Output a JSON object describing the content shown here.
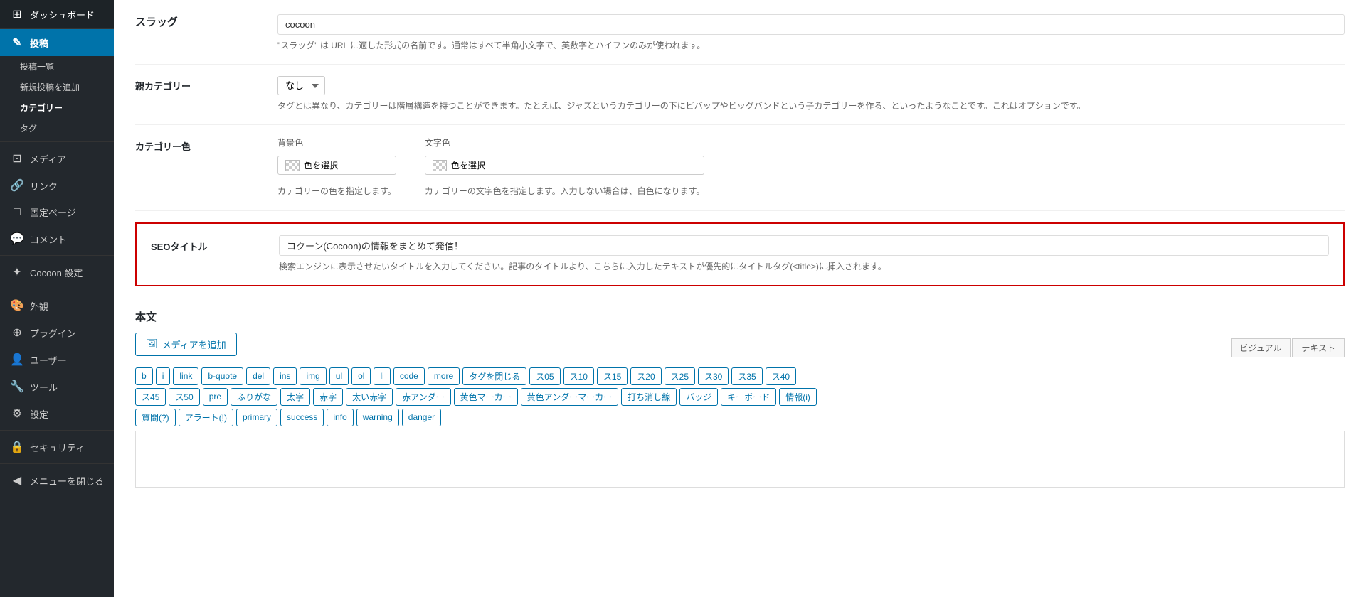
{
  "sidebar": {
    "logo": "ダッシュボード",
    "items": [
      {
        "id": "dashboard",
        "label": "ダッシュボード",
        "icon": "⊞",
        "active": false
      },
      {
        "id": "posts",
        "label": "投稿",
        "icon": "✎",
        "active": true
      },
      {
        "id": "posts-list",
        "label": "投稿一覧",
        "sub": true,
        "active": false
      },
      {
        "id": "posts-new",
        "label": "新規投稿を追加",
        "sub": true,
        "active": false
      },
      {
        "id": "categories",
        "label": "カテゴリー",
        "sub": true,
        "active": true
      },
      {
        "id": "tags",
        "label": "タグ",
        "sub": true,
        "active": false
      },
      {
        "id": "media",
        "label": "メディア",
        "icon": "⊡"
      },
      {
        "id": "links",
        "label": "リンク",
        "icon": "🔗"
      },
      {
        "id": "pages",
        "label": "固定ページ",
        "icon": "□"
      },
      {
        "id": "comments",
        "label": "コメント",
        "icon": "💬"
      },
      {
        "id": "cocoon",
        "label": "Cocoon 設定",
        "icon": "✦"
      },
      {
        "id": "appearance",
        "label": "外観",
        "icon": "🎨"
      },
      {
        "id": "plugins",
        "label": "プラグイン",
        "icon": "⊕"
      },
      {
        "id": "users",
        "label": "ユーザー",
        "icon": "👤"
      },
      {
        "id": "tools",
        "label": "ツール",
        "icon": "🔧"
      },
      {
        "id": "settings",
        "label": "設定",
        "icon": "⚙"
      },
      {
        "id": "security",
        "label": "セキュリティ",
        "icon": "🔒"
      },
      {
        "id": "close-menu",
        "label": "メニューを閉じる",
        "icon": "◀"
      }
    ]
  },
  "slug": {
    "label": "スラッグ",
    "value": "cocoon",
    "description": "\"スラッグ\" は URL に適した形式の名前です。通常はすべて半角小文字で、英数字とハイフンのみが使われます。"
  },
  "parent_category": {
    "label": "親カテゴリー",
    "value": "なし",
    "options": [
      "なし"
    ],
    "description": "タグとは異なり、カテゴリーは階層構造を持つことができます。たとえば、ジャズというカテゴリーの下にビバップやビッグバンドという子カテゴリーを作る、といったようなことです。これはオプションです。"
  },
  "category_color": {
    "label": "カテゴリー色",
    "bg_label": "背景色",
    "bg_btn": "色を選択",
    "text_label": "文字色",
    "text_btn": "色を選択",
    "bg_description": "カテゴリーの色を指定します。",
    "text_description": "カテゴリーの文字色を指定します。入力しない場合は、白色になります。"
  },
  "seo": {
    "label": "SEOタイトル",
    "value": "コクーン(Cocoon)の情報をまとめて発信！",
    "description": "検索エンジンに表示させたいタイトルを入力してください。記事のタイトルより、こちらに入力したテキストが優先的にタイトルタグ(<title>)に挿入されます。"
  },
  "body": {
    "label": "本文",
    "media_btn": "メディアを追加",
    "view_visual": "ビジュアル",
    "view_text": "テキスト",
    "tags_row1": [
      "b",
      "i",
      "link",
      "b-quote",
      "del",
      "ins",
      "img",
      "ul",
      "ol",
      "li",
      "code",
      "more",
      "タグを閉じる",
      "ス05",
      "ス10",
      "ス15",
      "ス20",
      "ス25",
      "ス30",
      "ス35",
      "ス40"
    ],
    "tags_row2": [
      "ス45",
      "ス50",
      "pre",
      "ふりがな",
      "太字",
      "赤字",
      "太い赤字",
      "赤アンダー",
      "黄色マーカー",
      "黄色アンダーマーカー",
      "打ち消し線",
      "バッジ",
      "キーボード",
      "情報(i)"
    ],
    "tags_row3": [
      "質問(?)",
      "アラート(!)",
      "primary",
      "success",
      "info",
      "warning",
      "danger"
    ]
  }
}
